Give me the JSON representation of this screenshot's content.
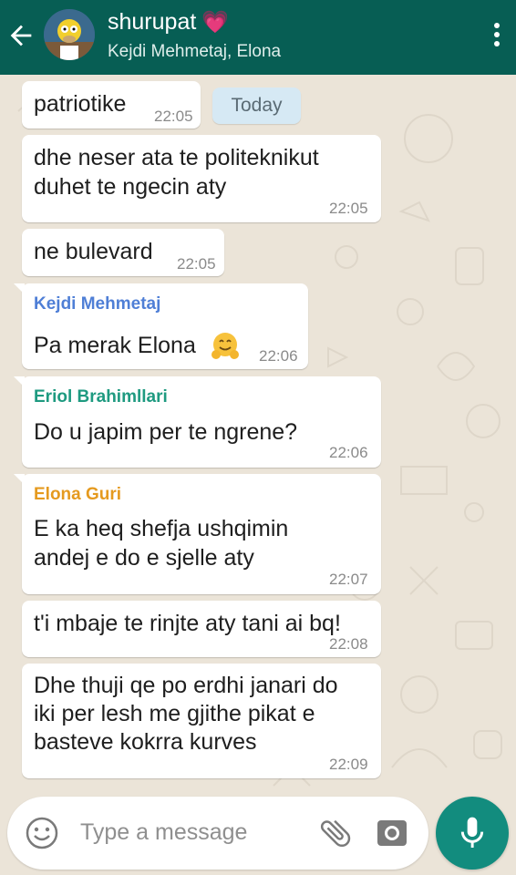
{
  "header": {
    "title": "shurupat",
    "title_emoji": "💗",
    "subtitle": "Kejdi Mehmetaj, Elona",
    "back_icon": "arrow-left-icon",
    "menu_icon": "more-vert-icon",
    "color": "#075e54"
  },
  "date_chip": "Today",
  "messages": [
    {
      "text_lines": [
        "patriotike"
      ],
      "time": "22:05"
    },
    {
      "text_lines": [
        "dhe neser ata te politeknikut",
        "duhet te ngecin aty"
      ],
      "time": "22:05"
    },
    {
      "text_lines": [
        "ne bulevard"
      ],
      "time": "22:05"
    },
    {
      "sender": "Kejdi Mehmetaj",
      "sender_color": "#4f7fd6",
      "text_lines": [
        "Pa merak Elona"
      ],
      "emoji": "hugging-face-icon",
      "time": "22:06"
    },
    {
      "sender": "Eriol Brahimllari",
      "sender_color": "#1e9a80",
      "text_lines": [
        "Do u japim per te ngrene?"
      ],
      "time": "22:06"
    },
    {
      "sender": "Elona Guri",
      "sender_color": "#e59a1f",
      "text_lines": [
        "E ka heq shefja ushqimin",
        "andej e do e sjelle aty"
      ],
      "time": "22:07"
    },
    {
      "text_lines": [
        "t'i mbaje te rinjte aty tani ai bq!"
      ],
      "time": "22:08"
    },
    {
      "text_lines": [
        "Dhe thuji qe po erdhi janari do",
        "iki per lesh me gjithe pikat e",
        "basteve kokrra kurves"
      ],
      "time": "22:09"
    }
  ],
  "input": {
    "placeholder": "Type a message",
    "emoji_icon": "emoji-icon",
    "attach_icon": "paperclip-icon",
    "camera_icon": "camera-icon",
    "mic_icon": "microphone-icon"
  }
}
